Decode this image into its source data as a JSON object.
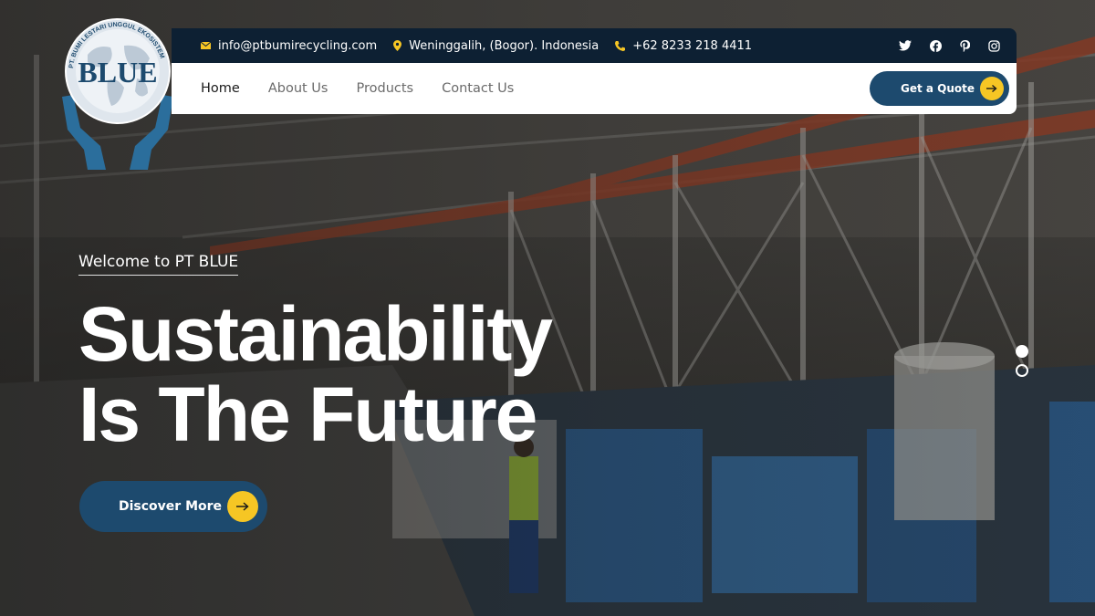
{
  "brand": {
    "logo_word": "BLUE",
    "logo_ring_text": "PT. BUMI LESTARI UNGGUL EKOSISTEM"
  },
  "topbar": {
    "email": "info@ptbumirecycling.com",
    "address": "Weninggalih, (Bogor). Indonesia",
    "phone": "+62 8233 218 4411",
    "socials": [
      "twitter-icon",
      "facebook-icon",
      "pinterest-icon",
      "instagram-icon"
    ]
  },
  "nav": {
    "items": [
      {
        "label": "Home",
        "active": true
      },
      {
        "label": "About Us",
        "active": false
      },
      {
        "label": "Products",
        "active": false
      },
      {
        "label": "Contact Us",
        "active": false
      }
    ],
    "cta_label": "Get a Quote"
  },
  "hero": {
    "eyebrow": "Welcome to PT BLUE",
    "headline_line1": "Sustainability",
    "headline_line2": "Is The Future",
    "button_label": "Discover More"
  },
  "slider": {
    "slide_count": 2,
    "active_index": 0
  },
  "colors": {
    "primary": "#1d4a6e",
    "topbar": "#0d2033",
    "accent": "#f6c624"
  }
}
